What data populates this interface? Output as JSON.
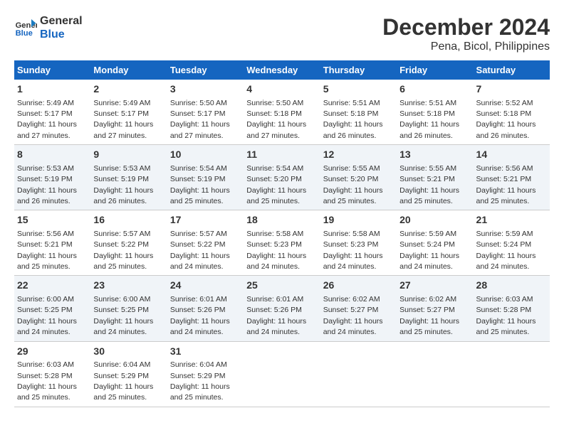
{
  "header": {
    "logo_line1": "General",
    "logo_line2": "Blue",
    "title": "December 2024",
    "subtitle": "Pena, Bicol, Philippines"
  },
  "days_of_week": [
    "Sunday",
    "Monday",
    "Tuesday",
    "Wednesday",
    "Thursday",
    "Friday",
    "Saturday"
  ],
  "weeks": [
    [
      {
        "day": "1",
        "sunrise": "Sunrise: 5:49 AM",
        "sunset": "Sunset: 5:17 PM",
        "daylight": "Daylight: 11 hours and 27 minutes."
      },
      {
        "day": "2",
        "sunrise": "Sunrise: 5:49 AM",
        "sunset": "Sunset: 5:17 PM",
        "daylight": "Daylight: 11 hours and 27 minutes."
      },
      {
        "day": "3",
        "sunrise": "Sunrise: 5:50 AM",
        "sunset": "Sunset: 5:17 PM",
        "daylight": "Daylight: 11 hours and 27 minutes."
      },
      {
        "day": "4",
        "sunrise": "Sunrise: 5:50 AM",
        "sunset": "Sunset: 5:18 PM",
        "daylight": "Daylight: 11 hours and 27 minutes."
      },
      {
        "day": "5",
        "sunrise": "Sunrise: 5:51 AM",
        "sunset": "Sunset: 5:18 PM",
        "daylight": "Daylight: 11 hours and 26 minutes."
      },
      {
        "day": "6",
        "sunrise": "Sunrise: 5:51 AM",
        "sunset": "Sunset: 5:18 PM",
        "daylight": "Daylight: 11 hours and 26 minutes."
      },
      {
        "day": "7",
        "sunrise": "Sunrise: 5:52 AM",
        "sunset": "Sunset: 5:18 PM",
        "daylight": "Daylight: 11 hours and 26 minutes."
      }
    ],
    [
      {
        "day": "8",
        "sunrise": "Sunrise: 5:53 AM",
        "sunset": "Sunset: 5:19 PM",
        "daylight": "Daylight: 11 hours and 26 minutes."
      },
      {
        "day": "9",
        "sunrise": "Sunrise: 5:53 AM",
        "sunset": "Sunset: 5:19 PM",
        "daylight": "Daylight: 11 hours and 26 minutes."
      },
      {
        "day": "10",
        "sunrise": "Sunrise: 5:54 AM",
        "sunset": "Sunset: 5:19 PM",
        "daylight": "Daylight: 11 hours and 25 minutes."
      },
      {
        "day": "11",
        "sunrise": "Sunrise: 5:54 AM",
        "sunset": "Sunset: 5:20 PM",
        "daylight": "Daylight: 11 hours and 25 minutes."
      },
      {
        "day": "12",
        "sunrise": "Sunrise: 5:55 AM",
        "sunset": "Sunset: 5:20 PM",
        "daylight": "Daylight: 11 hours and 25 minutes."
      },
      {
        "day": "13",
        "sunrise": "Sunrise: 5:55 AM",
        "sunset": "Sunset: 5:21 PM",
        "daylight": "Daylight: 11 hours and 25 minutes."
      },
      {
        "day": "14",
        "sunrise": "Sunrise: 5:56 AM",
        "sunset": "Sunset: 5:21 PM",
        "daylight": "Daylight: 11 hours and 25 minutes."
      }
    ],
    [
      {
        "day": "15",
        "sunrise": "Sunrise: 5:56 AM",
        "sunset": "Sunset: 5:21 PM",
        "daylight": "Daylight: 11 hours and 25 minutes."
      },
      {
        "day": "16",
        "sunrise": "Sunrise: 5:57 AM",
        "sunset": "Sunset: 5:22 PM",
        "daylight": "Daylight: 11 hours and 25 minutes."
      },
      {
        "day": "17",
        "sunrise": "Sunrise: 5:57 AM",
        "sunset": "Sunset: 5:22 PM",
        "daylight": "Daylight: 11 hours and 24 minutes."
      },
      {
        "day": "18",
        "sunrise": "Sunrise: 5:58 AM",
        "sunset": "Sunset: 5:23 PM",
        "daylight": "Daylight: 11 hours and 24 minutes."
      },
      {
        "day": "19",
        "sunrise": "Sunrise: 5:58 AM",
        "sunset": "Sunset: 5:23 PM",
        "daylight": "Daylight: 11 hours and 24 minutes."
      },
      {
        "day": "20",
        "sunrise": "Sunrise: 5:59 AM",
        "sunset": "Sunset: 5:24 PM",
        "daylight": "Daylight: 11 hours and 24 minutes."
      },
      {
        "day": "21",
        "sunrise": "Sunrise: 5:59 AM",
        "sunset": "Sunset: 5:24 PM",
        "daylight": "Daylight: 11 hours and 24 minutes."
      }
    ],
    [
      {
        "day": "22",
        "sunrise": "Sunrise: 6:00 AM",
        "sunset": "Sunset: 5:25 PM",
        "daylight": "Daylight: 11 hours and 24 minutes."
      },
      {
        "day": "23",
        "sunrise": "Sunrise: 6:00 AM",
        "sunset": "Sunset: 5:25 PM",
        "daylight": "Daylight: 11 hours and 24 minutes."
      },
      {
        "day": "24",
        "sunrise": "Sunrise: 6:01 AM",
        "sunset": "Sunset: 5:26 PM",
        "daylight": "Daylight: 11 hours and 24 minutes."
      },
      {
        "day": "25",
        "sunrise": "Sunrise: 6:01 AM",
        "sunset": "Sunset: 5:26 PM",
        "daylight": "Daylight: 11 hours and 24 minutes."
      },
      {
        "day": "26",
        "sunrise": "Sunrise: 6:02 AM",
        "sunset": "Sunset: 5:27 PM",
        "daylight": "Daylight: 11 hours and 24 minutes."
      },
      {
        "day": "27",
        "sunrise": "Sunrise: 6:02 AM",
        "sunset": "Sunset: 5:27 PM",
        "daylight": "Daylight: 11 hours and 25 minutes."
      },
      {
        "day": "28",
        "sunrise": "Sunrise: 6:03 AM",
        "sunset": "Sunset: 5:28 PM",
        "daylight": "Daylight: 11 hours and 25 minutes."
      }
    ],
    [
      {
        "day": "29",
        "sunrise": "Sunrise: 6:03 AM",
        "sunset": "Sunset: 5:28 PM",
        "daylight": "Daylight: 11 hours and 25 minutes."
      },
      {
        "day": "30",
        "sunrise": "Sunrise: 6:04 AM",
        "sunset": "Sunset: 5:29 PM",
        "daylight": "Daylight: 11 hours and 25 minutes."
      },
      {
        "day": "31",
        "sunrise": "Sunrise: 6:04 AM",
        "sunset": "Sunset: 5:29 PM",
        "daylight": "Daylight: 11 hours and 25 minutes."
      },
      null,
      null,
      null,
      null
    ]
  ]
}
